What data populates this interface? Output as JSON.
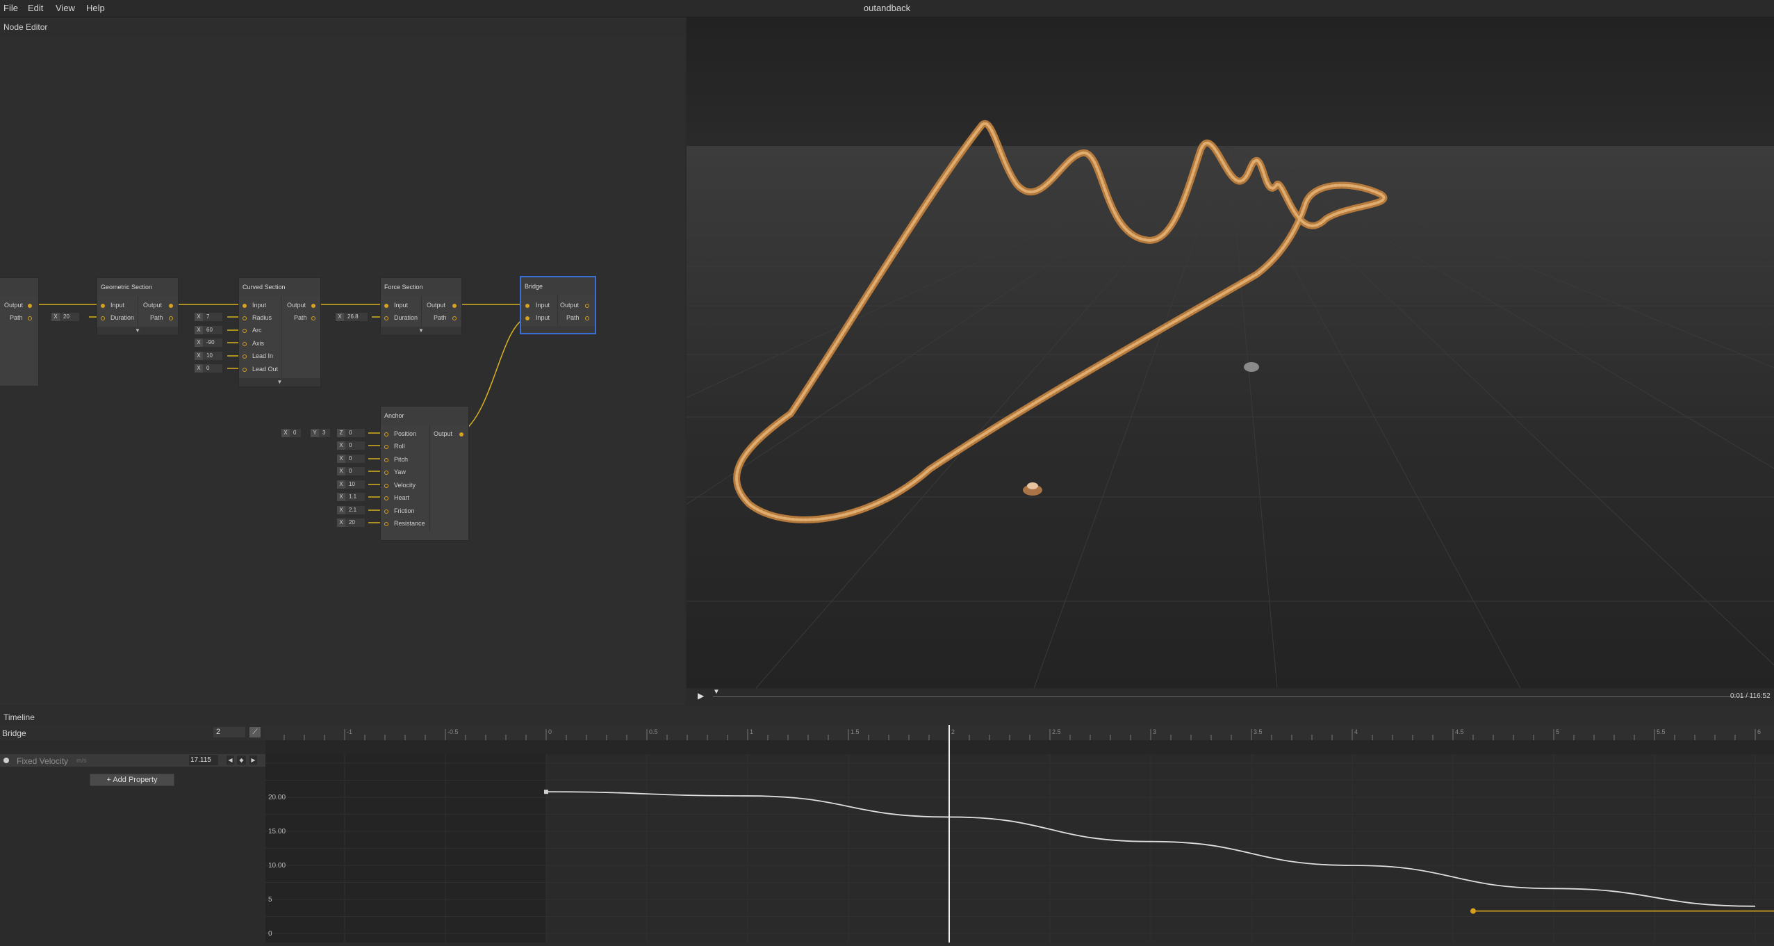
{
  "menu": {
    "file": "File",
    "edit": "Edit",
    "view": "View",
    "help": "Help"
  },
  "app_title": "outandback",
  "node_editor": {
    "title": "Node Editor",
    "nodes": {
      "partial": {
        "output": "Output",
        "path": "Path"
      },
      "geometric": {
        "title": "Geometric Section",
        "input": "Input",
        "duration": "Duration",
        "output": "Output",
        "path": "Path",
        "duration_axis": "X",
        "duration_value": "20",
        "footer": "▼"
      },
      "curved": {
        "title": "Curved Section",
        "input": "Input",
        "output": "Output",
        "path": "Path",
        "footer": "▼",
        "props": [
          {
            "label": "Radius",
            "axis": "X",
            "value": "7"
          },
          {
            "label": "Arc",
            "axis": "X",
            "value": "60"
          },
          {
            "label": "Axis",
            "axis": "X",
            "value": "-90"
          },
          {
            "label": "Lead In",
            "axis": "X",
            "value": "10"
          },
          {
            "label": "Lead Out",
            "axis": "X",
            "value": "0"
          }
        ]
      },
      "force": {
        "title": "Force Section",
        "input": "Input",
        "duration": "Duration",
        "output": "Output",
        "path": "Path",
        "duration_axis": "X",
        "duration_value": "26.8",
        "footer": "▼"
      },
      "bridge": {
        "title": "Bridge",
        "input1": "Input",
        "input2": "Input",
        "output": "Output",
        "path": "Path"
      },
      "anchor": {
        "title": "Anchor",
        "output": "Output",
        "position": {
          "label": "Position",
          "x_axis": "X",
          "x": "0",
          "y_axis": "Y",
          "y": "3",
          "z_axis": "Z",
          "z": "0"
        },
        "props": [
          {
            "label": "Roll",
            "axis": "X",
            "value": "0"
          },
          {
            "label": "Pitch",
            "axis": "X",
            "value": "0"
          },
          {
            "label": "Yaw",
            "axis": "X",
            "value": "0"
          },
          {
            "label": "Velocity",
            "axis": "X",
            "value": "10"
          },
          {
            "label": "Heart",
            "axis": "X",
            "value": "1.1"
          },
          {
            "label": "Friction",
            "axis": "X",
            "value": "2.1"
          },
          {
            "label": "Resistance",
            "axis": "X",
            "value": "20"
          }
        ]
      }
    }
  },
  "viewport": {
    "time": "0:01 / 116:52"
  },
  "timeline": {
    "title": "Timeline",
    "track_name": "Bridge",
    "track_value": "2",
    "property": {
      "name": "Fixed Velocity",
      "unit": "m/s",
      "value": "17.115"
    },
    "add_property": "+ Add Property",
    "ruler": [
      "-1",
      "-0.5",
      "0",
      "0.5",
      "1",
      "1.5",
      "2",
      "2.5",
      "3",
      "3.5",
      "4",
      "4.5",
      "5",
      "5.5",
      "6"
    ],
    "y_labels": [
      "20.00",
      "15.00",
      "10.00",
      "5",
      "0"
    ],
    "playhead": 2,
    "curve": {
      "x": [
        0,
        1,
        2,
        3,
        4,
        5,
        6
      ],
      "y": [
        20.8,
        20.2,
        17.1,
        13.5,
        10.0,
        6.6,
        4.0
      ]
    },
    "orange_key": {
      "x": 4.6,
      "y": 3.3
    }
  },
  "colors": {
    "accent": "#d6a21f",
    "selection": "#3a6fd8",
    "track": "#c8914f"
  }
}
